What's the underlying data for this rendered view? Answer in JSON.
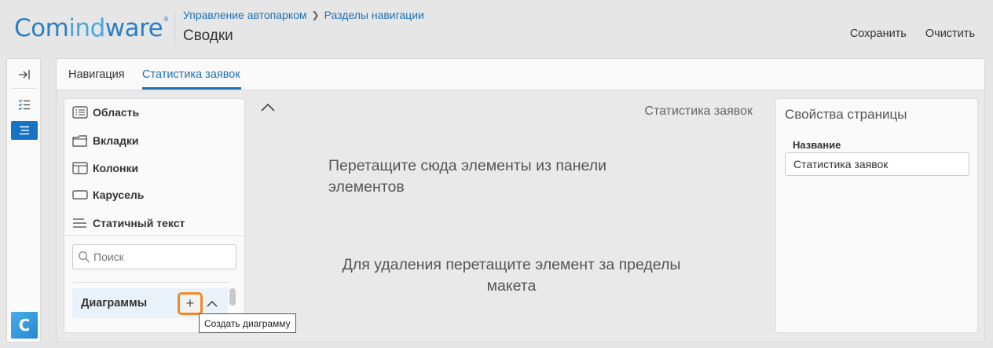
{
  "header": {
    "logo_part1": "Com",
    "logo_part2": "ind",
    "logo_part3": "ware",
    "logo_reg": "®",
    "breadcrumb": [
      "Управление автопарком",
      "Разделы навигации"
    ],
    "title": "Сводки",
    "actions": {
      "save": "Сохранить",
      "clear": "Очистить"
    }
  },
  "rail": {
    "items": [
      "collapse-arrow-icon",
      "checklist-icon",
      "list-icon"
    ],
    "bottom_logo": "C"
  },
  "tabs": [
    {
      "label": "Навигация",
      "active": false
    },
    {
      "label": "Статистика заявок",
      "active": true
    }
  ],
  "elements_panel": {
    "items": [
      {
        "label": "Область",
        "icon": "area-icon"
      },
      {
        "label": "Вкладки",
        "icon": "tabs-icon"
      },
      {
        "label": "Колонки",
        "icon": "columns-icon"
      },
      {
        "label": "Карусель",
        "icon": "carousel-icon"
      },
      {
        "label": "Статичный текст",
        "icon": "static-text-icon"
      }
    ],
    "search_placeholder": "Поиск",
    "category": "Диаграммы",
    "add_symbol": "+"
  },
  "canvas": {
    "title": "Статистика заявок",
    "drop_hint": "Перетащите сюда элементы из панели элементов",
    "delete_hint": "Для удаления перетащите элемент за пределы макета"
  },
  "properties": {
    "title": "Свойства страницы",
    "name_label": "Название",
    "name_value": "Статистика заявок"
  },
  "tooltip": "Создать диаграмму",
  "colors": {
    "accent": "#2171b5",
    "highlight": "#f08a24",
    "logo_dark": "#2c7fc4",
    "logo_light": "#4aa7e0"
  }
}
